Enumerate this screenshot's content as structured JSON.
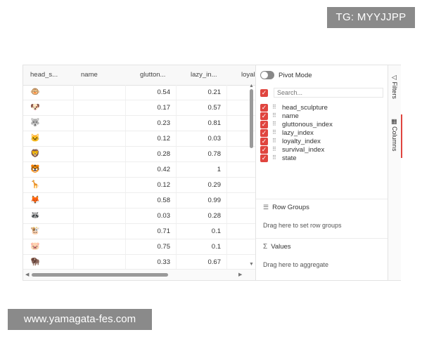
{
  "watermarks": {
    "telegram": "TG: MYYJJPP",
    "website": "www.yamagata-fes.com"
  },
  "grid": {
    "headers": [
      "head_s...",
      "name",
      "glutton...",
      "lazy_in...",
      "loyal"
    ],
    "rows": [
      {
        "icon": "🐵",
        "name": "",
        "gluttonous": "0.54",
        "lazy": "0.21"
      },
      {
        "icon": "🐶",
        "name": "",
        "gluttonous": "0.17",
        "lazy": "0.57"
      },
      {
        "icon": "🐺",
        "name": "",
        "gluttonous": "0.23",
        "lazy": "0.81"
      },
      {
        "icon": "🐱",
        "name": "",
        "gluttonous": "0.12",
        "lazy": "0.03"
      },
      {
        "icon": "🦁",
        "name": "",
        "gluttonous": "0.28",
        "lazy": "0.78"
      },
      {
        "icon": "🐯",
        "name": "",
        "gluttonous": "0.42",
        "lazy": "1"
      },
      {
        "icon": "🦒",
        "name": "",
        "gluttonous": "0.12",
        "lazy": "0.29"
      },
      {
        "icon": "🦊",
        "name": "",
        "gluttonous": "0.58",
        "lazy": "0.99"
      },
      {
        "icon": "🦝",
        "name": "",
        "gluttonous": "0.03",
        "lazy": "0.28"
      },
      {
        "icon": "🐮",
        "name": "",
        "gluttonous": "0.71",
        "lazy": "0.1"
      },
      {
        "icon": "🐷",
        "name": "",
        "gluttonous": "0.75",
        "lazy": "0.1"
      },
      {
        "icon": "🦬",
        "name": "",
        "gluttonous": "0.33",
        "lazy": "0.67"
      }
    ]
  },
  "panel": {
    "pivot_label": "Pivot Mode",
    "search_placeholder": "Search...",
    "columns": [
      "head_sculpture",
      "name",
      "gluttonous_index",
      "lazy_index",
      "loyalty_index",
      "survival_index",
      "state"
    ],
    "row_groups_title": "Row Groups",
    "row_groups_hint": "Drag here to set row groups",
    "values_title": "Values",
    "values_hint": "Drag here to aggregate"
  },
  "side_tabs": {
    "filters": "Filters",
    "columns": "Columns"
  },
  "colors": {
    "accent": "#e0453f",
    "badge_bg": "#8a8a8a"
  }
}
